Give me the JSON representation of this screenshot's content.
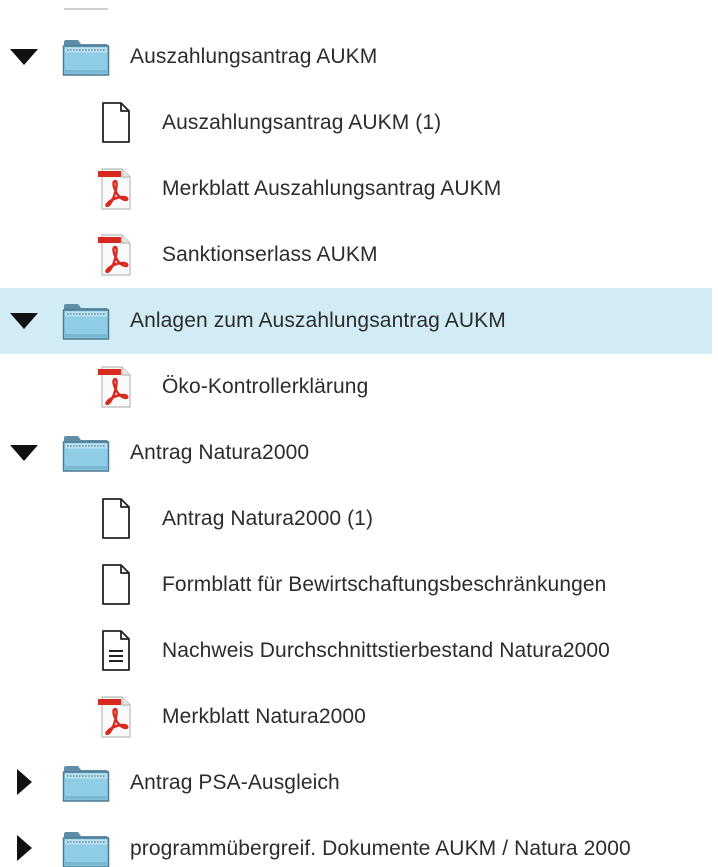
{
  "tree": {
    "items": [
      {
        "kind": "folder",
        "label": "Auszahlungsantrag AUKM",
        "expanded": true,
        "selected": false
      },
      {
        "kind": "file",
        "file_type": "blank",
        "label": "Auszahlungsantrag AUKM (1)"
      },
      {
        "kind": "file",
        "file_type": "pdf",
        "label": "Merkblatt Auszahlungsantrag AUKM"
      },
      {
        "kind": "file",
        "file_type": "pdf",
        "label": "Sanktionserlass AUKM"
      },
      {
        "kind": "folder",
        "label": "Anlagen zum Auszahlungsantrag AUKM",
        "expanded": true,
        "selected": true
      },
      {
        "kind": "file",
        "file_type": "pdf",
        "label": "Öko-Kontrollerklärung"
      },
      {
        "kind": "folder",
        "label": "Antrag Natura2000",
        "expanded": true,
        "selected": false
      },
      {
        "kind": "file",
        "file_type": "blank",
        "label": "Antrag Natura2000 (1)"
      },
      {
        "kind": "file",
        "file_type": "blank",
        "label": "Formblatt für Bewirtschaftungsbeschränkungen"
      },
      {
        "kind": "file",
        "file_type": "text",
        "label": "Nachweis Durchschnittstierbestand Natura2000"
      },
      {
        "kind": "file",
        "file_type": "pdf",
        "label": "Merkblatt Natura2000"
      },
      {
        "kind": "folder",
        "label": "Antrag PSA-Ausgleich",
        "expanded": false,
        "selected": false
      },
      {
        "kind": "folder",
        "label": "programmübergreif. Dokumente AUKM / Natura 2000",
        "expanded": false,
        "selected": false
      }
    ]
  },
  "colors": {
    "selected_row": "#d2ecf5",
    "folder": "#8fcde6",
    "pdf_red": "#d8291f"
  }
}
